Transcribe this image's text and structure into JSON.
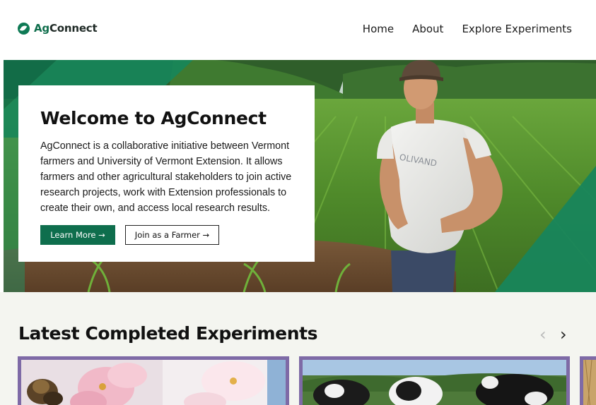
{
  "header": {
    "logo": {
      "prefix": "Ag",
      "suffix": "Connect",
      "icon": "leaf-icon"
    },
    "nav": [
      {
        "label": "Home"
      },
      {
        "label": "About"
      },
      {
        "label": "Explore Experiments"
      }
    ]
  },
  "hero": {
    "title": "Welcome to AgConnect",
    "body": "AgConnect is a collaborative initiative between Vermont farmers and University of Vermont Extension. It allows farmers and other agricultural stakeholders to join active research projects, work with Extension professionals to create their own, and access local research results.",
    "primary_button": "Learn More →",
    "secondary_button": "Join as a Farmer →",
    "image_icon": "farmer-in-cornfield-photo"
  },
  "latest": {
    "title": "Latest Completed Experiments",
    "prev_icon": "chevron-left-icon",
    "next_icon": "chevron-right-icon",
    "prev_symbol": "‹",
    "next_symbol": "›",
    "cards": [
      {
        "image": "bee-on-blossom-photo"
      },
      {
        "image": "dairy-cows-photo"
      },
      {
        "image": "hay-photo"
      }
    ]
  },
  "colors": {
    "brand_green": "#0e6e4d",
    "card_border": "#7e6aa6",
    "section_bg": "#f4f5f0"
  }
}
